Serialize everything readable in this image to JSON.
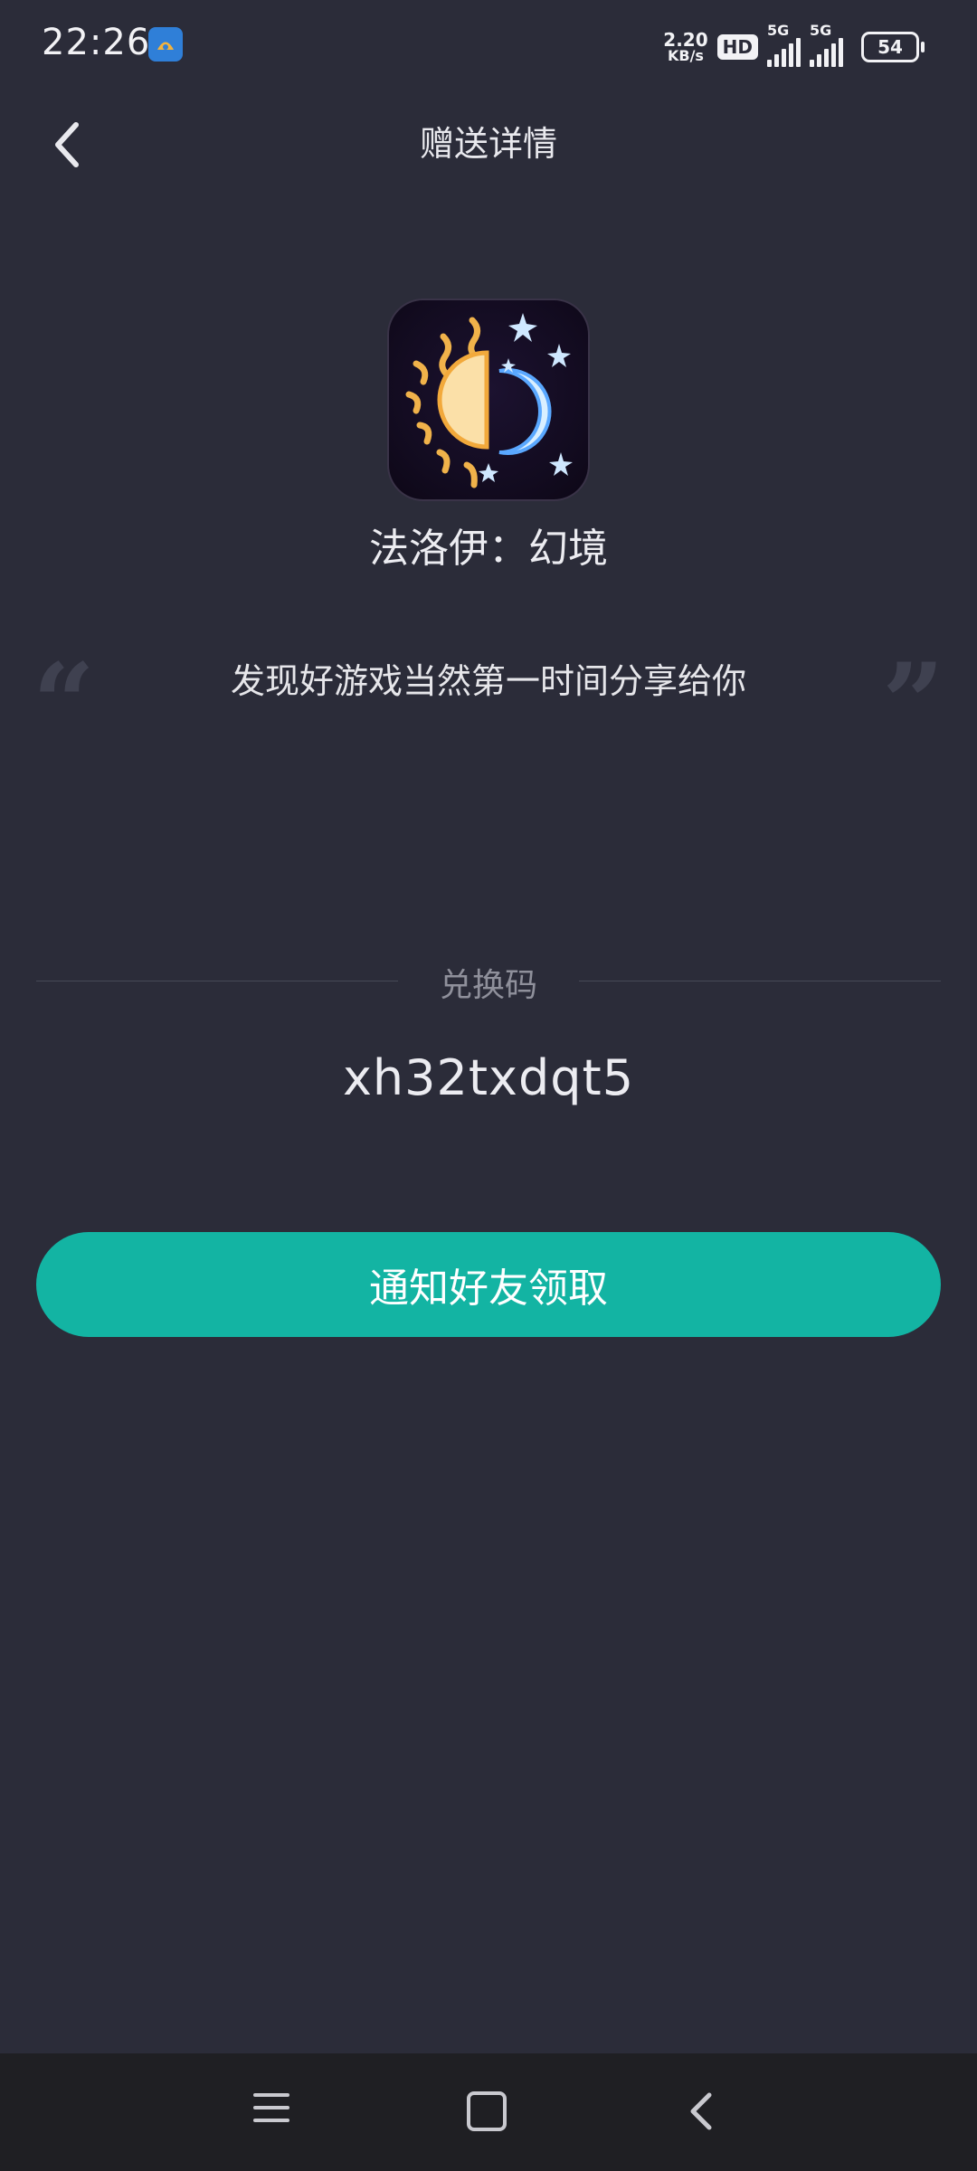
{
  "status_bar": {
    "time": "22:26",
    "net_speed_value": "2.20",
    "net_speed_unit": "KB/s",
    "hd_label": "HD",
    "signal1_label": "5G",
    "signal2_label": "5G",
    "battery": "54"
  },
  "header": {
    "title": "赠送详情",
    "back_icon": "chevron-left-icon"
  },
  "game": {
    "name": "法洛伊：幻境",
    "icon": "sun-moon-game-icon"
  },
  "share_message": "发现好游戏当然第一时间分享给你",
  "redeem": {
    "label": "兑换码",
    "code": "xh32txdqt5"
  },
  "actions": {
    "notify_label": "通知好友领取",
    "button_color": "#13b4a3"
  },
  "nav": {
    "menu_icon": "menu-icon",
    "home_icon": "home-icon",
    "back_icon": "back-icon"
  }
}
